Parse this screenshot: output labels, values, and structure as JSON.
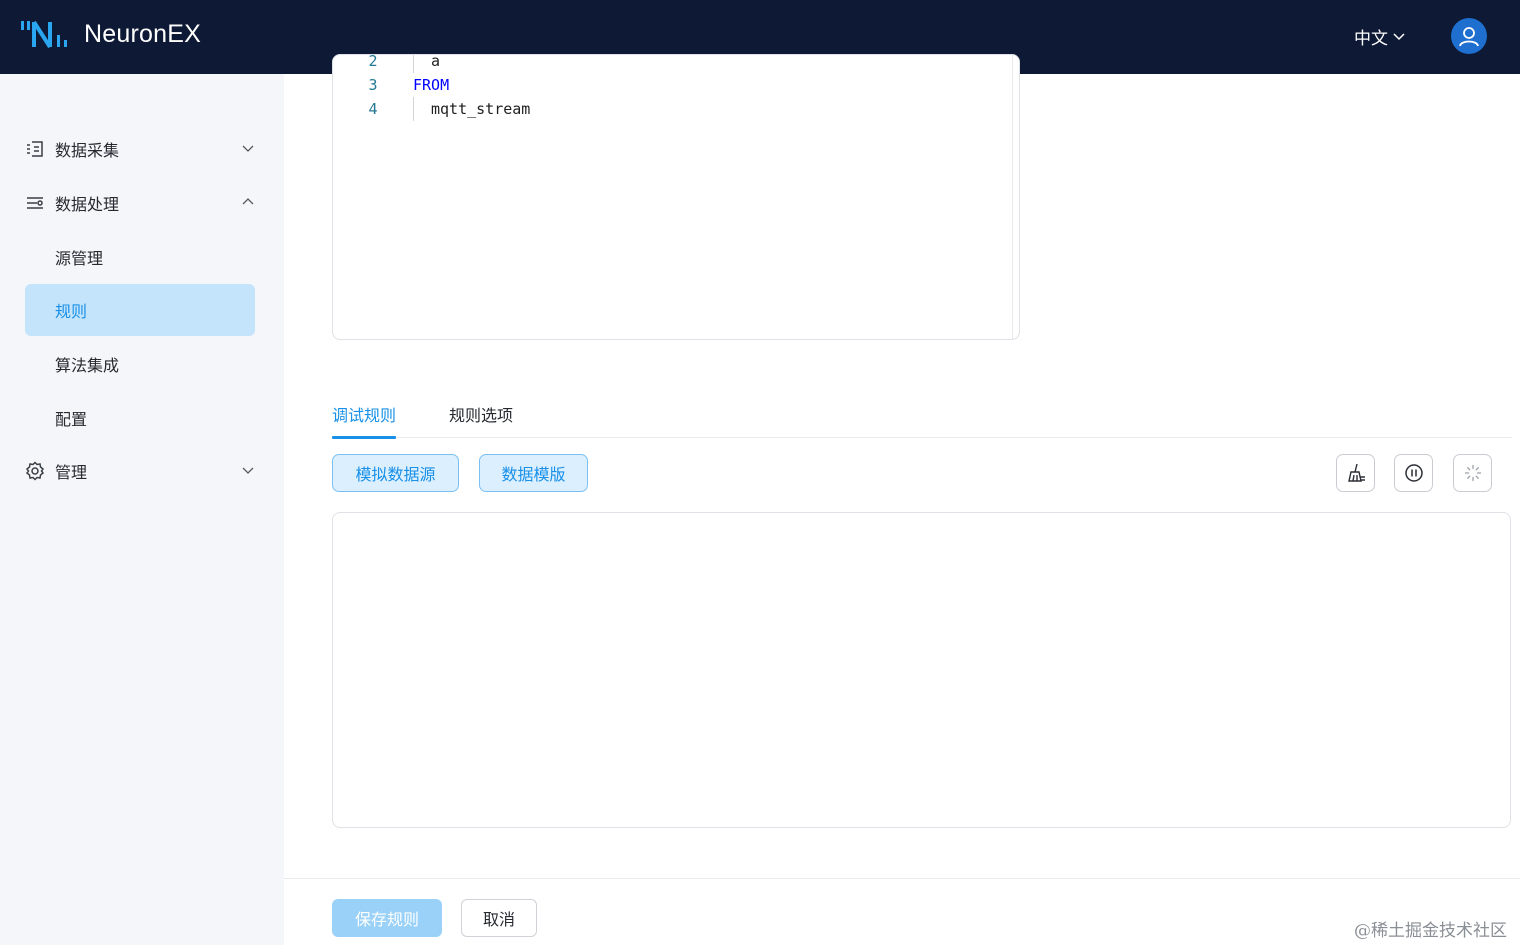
{
  "header": {
    "brand": "NeuronEX",
    "language": "中文"
  },
  "sidebar": {
    "groups": [
      {
        "label": "数据采集",
        "icon": "data-collection-icon",
        "expanded": false
      },
      {
        "label": "数据处理",
        "icon": "data-processing-icon",
        "expanded": true,
        "items": [
          {
            "label": "源管理",
            "active": false
          },
          {
            "label": "规则",
            "active": true
          },
          {
            "label": "算法集成",
            "active": false
          },
          {
            "label": "配置",
            "active": false
          }
        ]
      },
      {
        "label": "管理",
        "icon": "gear-icon",
        "expanded": false
      }
    ]
  },
  "editor": {
    "lines": [
      {
        "number": "2",
        "text": "a"
      },
      {
        "number": "3",
        "text": "FROM"
      },
      {
        "number": "4",
        "text": "mqtt_stream"
      }
    ]
  },
  "tabs": [
    {
      "label": "调试规则",
      "active": true
    },
    {
      "label": "规则选项",
      "active": false
    }
  ],
  "debug": {
    "mock_source_label": "模拟数据源",
    "data_template_label": "数据模版",
    "tools": [
      "clear-icon",
      "pause-icon",
      "loading-icon"
    ]
  },
  "footer": {
    "save_label": "保存规则",
    "cancel_label": "取消"
  },
  "watermark": "@稀土掘金技术社区",
  "colors": {
    "header_bg": "#0e1a35",
    "accent": "#1890e8",
    "active_nav_bg": "#c3e4fb",
    "sidebar_bg": "#f4f6f9"
  }
}
